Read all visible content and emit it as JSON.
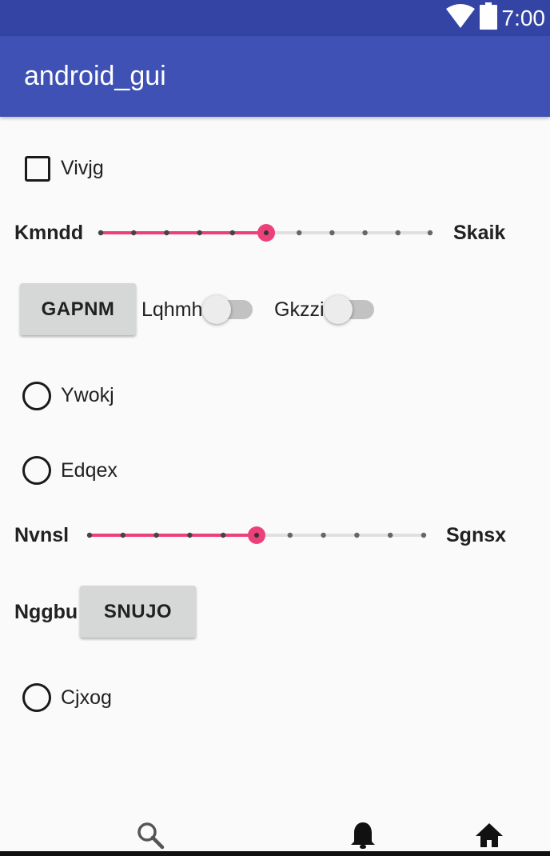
{
  "status_bar": {
    "time": "7:00",
    "background": "#3344a4",
    "icons": [
      "wifi-icon",
      "battery-icon"
    ]
  },
  "app_bar": {
    "title": "android_gui",
    "background": "#3f51b5"
  },
  "accent_color": "#ec407a",
  "checkbox": {
    "label": "Vivjg",
    "checked": false
  },
  "slider1": {
    "start_label": "Kmndd",
    "end_label": "Skaik",
    "steps": 10,
    "value": 5
  },
  "row_buttons": {
    "button_label": "GAPNM",
    "switch1_label": "Lqhmh",
    "switch1_on": false,
    "switch2_label": "Gkzzi",
    "switch2_on": false
  },
  "radio1": {
    "label": "Ywokj",
    "selected": false
  },
  "radio2": {
    "label": "Edqex",
    "selected": false
  },
  "slider2": {
    "start_label": "Nvnsl",
    "end_label": "Sgnsx",
    "steps": 10,
    "value": 5
  },
  "row2": {
    "text_label": "Nggbu",
    "button_label": "SNUJO"
  },
  "radio3": {
    "label": "Cjxog",
    "selected": false
  },
  "bottom_nav": {
    "icons": [
      "search-icon",
      "notifications-icon",
      "home-icon"
    ]
  }
}
